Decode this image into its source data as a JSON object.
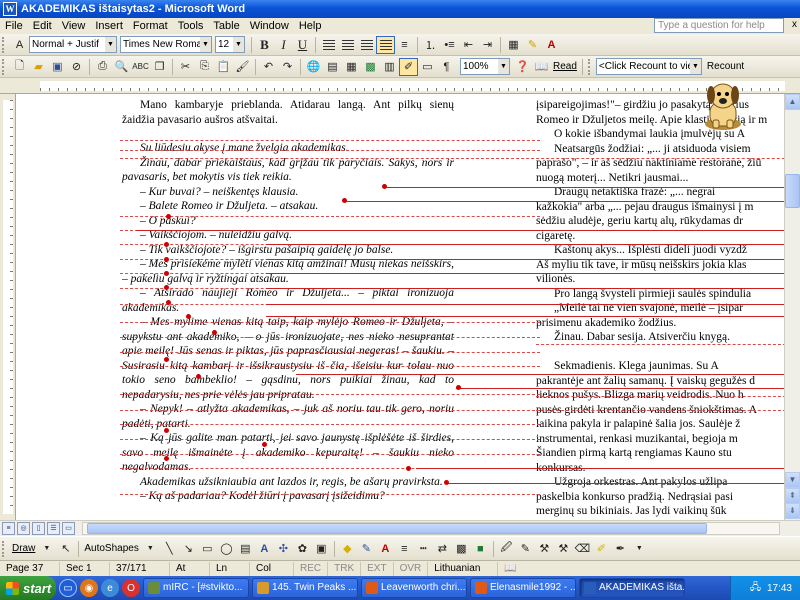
{
  "window": {
    "title": "AKADEMIKAS ištaisytas2 - Microsoft Word"
  },
  "menu": {
    "items": [
      "File",
      "Edit",
      "View",
      "Insert",
      "Format",
      "Tools",
      "Table",
      "Window",
      "Help"
    ],
    "question_placeholder": "Type a question for help",
    "close_glyph": "x"
  },
  "format_toolbar": {
    "style": "Normal + Justif",
    "font": "Times New Roman",
    "size": "12",
    "bold": "B",
    "italic": "I",
    "underline": "U"
  },
  "standard_toolbar": {
    "zoom": "100%",
    "read_label": "Read",
    "click_recount": "<Click Recount to view>",
    "recount_label": "Recount"
  },
  "doc": {
    "left_column": [
      {
        "text": "Mano kambaryje prieblanda. Atidarau langą. Ant pilkų sienų žaidžia pavasario aušros atšvaitai.",
        "style": "ind"
      },
      {
        "text": "Su liūdesiu akyse į mane žvelgia akademikas.",
        "style": "ind it gap"
      },
      {
        "text": "Žinau, dabar priekaištaus, kad grįžau tik paryčiais. Sakys, nors ir pavasaris, bet mokytis vis tiek reikia.",
        "style": "ind it"
      },
      {
        "text": "– Kur buvai? – neiškentęs klausia.",
        "style": "ind it"
      },
      {
        "text": "– Balete Romeo ir Džuljeta. – atsakau.",
        "style": "ind it"
      },
      {
        "text": "– O paskui?",
        "style": "ind it"
      },
      {
        "text": "– Vaikščiojom. – nuleidžiu galvą.",
        "style": "ind it"
      },
      {
        "text": "– Tik vaikščiojote? – išgirstu pašaipią gaidelę jo balse.",
        "style": "ind it"
      },
      {
        "text": "– Mes prisiekėme mylėti vienas kitą amžinai! Mūsų niekas neišskirs, – pakeliu galvą ir ryžtingai atsakau.",
        "style": "ind it"
      },
      {
        "text": "– Atsirado naujieji Romeo ir Džuljeta... – piktai ironizuoja akademikas.",
        "style": "ind it"
      },
      {
        "text": "– Mes mylime vienas kitą taip, kaip mylėjo Romeo ir Džuljeta, – supykstu ant akademiko, – o jūs ironizuojate, nes nieko nesuprantat apie meilę! Jūs senas ir piktas, jūs paprasčiausiai negeras! – šaukiu. – Susirasiu kitą kambarį ir išsikraustysiu iš čia, išeisiu kur tolau nuo tokio seno bambeklio! – gąsdinu, nors puikiai žinau, kad to nepadarysiu, nes prie vėlės jau pripratau.",
        "style": "ind it"
      },
      {
        "text": "– Nepyk! – atlyžta akademikas, – juk aš noriu tau tik gero, noriu padėti, patarti.",
        "style": "ind it"
      },
      {
        "text": "– Ką jūs galite man patarti, jei savo jaunystę išplėšėte iš širdies, savo meilę išmainėte į akademiko kepuraitę! – šaukiu nieko negalvodamas.",
        "style": "ind it"
      },
      {
        "text": "Akademikas užsikniaubia ant lazdos ir, regis, be ašarų pravirksta.",
        "style": "ind it"
      },
      {
        "text": "– Ką aš padariau? Kodėl žiūri į pavasarį įsižeidimu?",
        "style": "ind it"
      }
    ],
    "right_column": [
      "įsipareigojimas!\"– girdžiu jo pasakytą žodžius",
      "Romeo ir Džuljetos meilę. Apie klastingančią ir m",
      "O kokie išbandymai laukia įmulvėjų su A",
      "Neatsargūs žodžiai: „... ji atsiduoda visiem",
      "paprašo\", – ir aš sėdžiu naktiniame restorane, žiū",
      "nuogą moterį... Netikri jausmai...",
      "Draugų netaktiška frazė: „... negrai",
      "kažkokia\" arba „... pejau draugus išmainysi į m",
      "sėdžiu aludėje, geriu kartų alų, rūkydamas dr",
      "cigaretę.",
      "Kaštonų akys... Išplėsti dideli juodi vyzdž",
      "Aš myliu tik tave, ir mūsų neišskirs jokia klas",
      "vilionės.",
      "Pro langą švysteli pirmieji saulės spindulia",
      "„Meilė tai ne vien svajonė, meilė – įsipar",
      "prisimenu akademiko žodžius.",
      "Žinau. Dabar sesija. Atsiverčiu knygą.",
      "",
      "Sekmadienis. Klega jaunimas. Su A",
      "pakrantėje ant žalių samanų. Į vaiskų gegužės d",
      "lieknos pušys. Blizga marių veidrodis. Nuo h",
      "pusės girdėti krentančio vandens šniokštimas. A",
      "laikina pakyla ir palapinė šalia jos. Saulėje ž",
      "instrumentai, renkasi muzikantai, begioja m",
      "Šiandien pirmą kartą rengiamas Kauno stu",
      "konkursas.",
      "Užgroja orkestras. Ant pakylos užlipa",
      "paskelbia konkurso pradžią. Nedrąsiai pasi",
      "merginų su bikiniais. Jas lydi vaikinų šūk",
      "šūkiai vis. Merginos susirašiu, patrauk kad jie"
    ]
  },
  "drawbar": {
    "draw_label": "Draw",
    "autoshapes_label": "AutoShapes"
  },
  "status": {
    "page": "Page 37",
    "sec": "Sec 1",
    "pages": "37/171",
    "at": "At",
    "ln": "Ln",
    "col": "Col",
    "rec": "REC",
    "trk": "TRK",
    "ext": "EXT",
    "ovr": "OVR",
    "lang": "Lithuanian"
  },
  "taskbar": {
    "start": "start",
    "tasks": [
      {
        "label": "mIRC - [#stvikto...",
        "color": "#6b8d3b"
      },
      {
        "label": "145. Twin Peaks ...",
        "color": "#d89b2b"
      },
      {
        "label": "Leavenworth chri...",
        "color": "#e05a16"
      },
      {
        "label": "Elenasmile1992 - ...",
        "color": "#e05a16"
      },
      {
        "label": "AKADEMIKAS išta...",
        "color": "#2a5db8"
      }
    ],
    "clock": "17:43"
  }
}
